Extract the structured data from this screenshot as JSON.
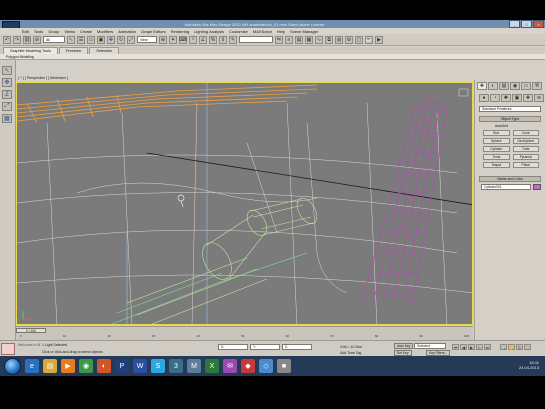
{
  "window": {
    "title": "Autodesk 3ds Max Design 2012 x64   shadowbrick_01.max   Stand-alone License",
    "controls": [
      "_",
      "□",
      "×"
    ]
  },
  "menus": [
    "Edit",
    "Tools",
    "Group",
    "Views",
    "Create",
    "Modifiers",
    "Animation",
    "Graph Editors",
    "Rendering",
    "Lighting Analysis",
    "Customize",
    "MAXScript",
    "Help",
    "Scene Manager"
  ],
  "toolbar": {
    "selection_filter": "All",
    "reference_coord": "View",
    "named_selection": "",
    "search_label": "Create Selection Set"
  },
  "ribbon": {
    "tabs": [
      "Graphite Modeling Tools",
      "Freeform",
      "Selection"
    ],
    "active_tab": "Graphite Modeling Tools",
    "panel_label": "Polygon Modeling"
  },
  "left_tools": [
    "↖",
    "✥",
    "Z",
    "⤢",
    "▦"
  ],
  "viewport": {
    "label": "[ + ] [ Perspective ] [ Wireframe ]",
    "border_color": "#e6d84e",
    "background": "#7b7b7b"
  },
  "command_panel": {
    "tabs": [
      "✚",
      "◐",
      "▤",
      "◉",
      "▭",
      "⚒"
    ],
    "dropdown": "Standard Primitives",
    "rollout_object_type": "Object Type",
    "autogrid": "AutoGrid",
    "objects": [
      "Box",
      "Cone",
      "Sphere",
      "GeoSphere",
      "Cylinder",
      "Tube",
      "Torus",
      "Pyramid",
      "Teapot",
      "Plane"
    ],
    "rollout_name_color": "Name and Color",
    "object_name": "Cylinder001",
    "color": "#cc66cc"
  },
  "timeline": {
    "slider": "0 / 100",
    "ticks": [
      "0",
      "10",
      "20",
      "30",
      "40",
      "50",
      "60",
      "70",
      "80",
      "90",
      "100"
    ]
  },
  "status": {
    "selection": "1 Light Selected",
    "prompt": "Click or click-and-drag to select objects",
    "x": "X: ",
    "y": "Y: ",
    "z": "Z: ",
    "grid": "Grid = 10.0cm",
    "auto_key": "Auto Key",
    "set_key": "Set Key",
    "selected": "Selected",
    "key_filters": "Key Filters...",
    "add_time_tag": "Add Time Tag",
    "welcome": "Welcome to M"
  },
  "taskbar": {
    "apps": [
      "IE",
      "Explorer",
      "Media",
      "Chrome",
      "Firefox",
      "PS",
      "Word",
      "Skype",
      "3ds",
      "Max",
      "Excel",
      "Mail",
      "App",
      "App",
      "App"
    ],
    "time": "18:11",
    "date": "24.04.2013"
  }
}
